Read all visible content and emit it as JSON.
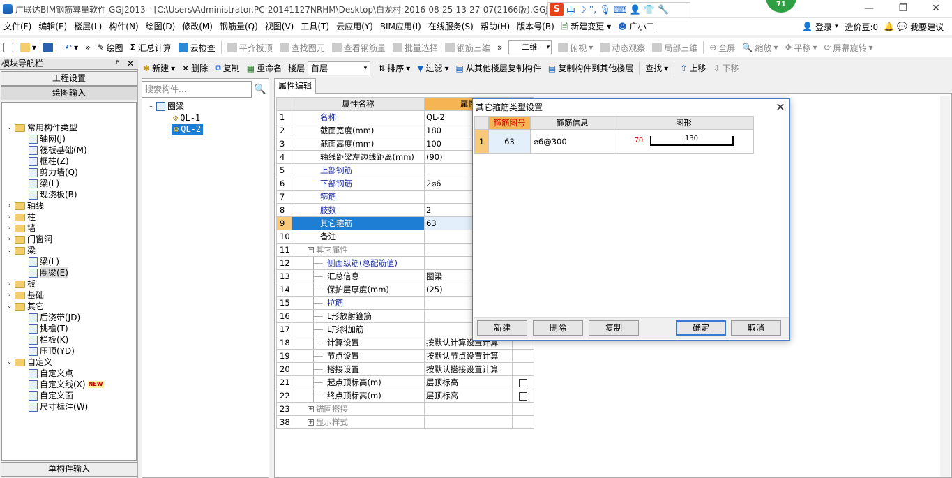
{
  "window": {
    "title": "广联达BIM钢筋算量软件 GGJ2013 - [C:\\Users\\Administrator.PC-20141127NRHM\\Desktop\\白龙村-2016-08-25-13-27-07(2166版).GGJ12]",
    "ime": {
      "logo": "S",
      "mode": "中"
    },
    "badge": "71",
    "controls": {
      "minimize": "—",
      "restore": "❐",
      "close": "✕"
    }
  },
  "menu": {
    "items": [
      "文件(F)",
      "编辑(E)",
      "楼层(L)",
      "构件(N)",
      "绘图(D)",
      "修改(M)",
      "钢筋量(Q)",
      "视图(V)",
      "工具(T)",
      "云应用(Y)",
      "BIM应用(I)",
      "在线服务(S)",
      "帮助(H)",
      "版本号(B)"
    ],
    "new_change": "新建变更",
    "assistant": "广小二",
    "login": "登录",
    "price_bean": "造价豆:0",
    "feedback": "我要建议"
  },
  "toolbar1": {
    "draw": "绘图",
    "sum": "汇总计算",
    "cloud_check": "云检查",
    "align_slab": "平齐板顶",
    "find_element": "查找图元",
    "view_rebar": "查看钢筋量",
    "batch_select": "批量选择",
    "rebar_3d": "钢筋三维",
    "view_mode": "二维",
    "top_view": "俯视",
    "dynamic_view": "动态观察",
    "local_3d": "局部三维",
    "fullscreen": "全屏",
    "zoom": "缩放",
    "pan": "平移",
    "rotate": "屏幕旋转"
  },
  "toolbar2": {
    "new": "新建",
    "delete": "删除",
    "copy": "复制",
    "rename": "重命名",
    "floor_label": "楼层",
    "floor_value": "首层",
    "sort": "排序",
    "filter": "过滤",
    "copy_from_floor": "从其他楼层复制构件",
    "copy_to_floor": "复制构件到其他楼层",
    "find": "查找",
    "move_up": "上移",
    "move_down": "下移"
  },
  "left_panel": {
    "title": "模块导航栏",
    "pin": "ᴾ",
    "close": "✕",
    "project_settings": "工程设置",
    "drawing_input": "绘图输入",
    "single_input": "单构件输入",
    "tree": [
      {
        "label": "常用构件类型",
        "level": 0,
        "exp": "⌄",
        "type": "folder"
      },
      {
        "label": "轴网(J)",
        "level": 1,
        "type": "item"
      },
      {
        "label": "筏板基础(M)",
        "level": 1,
        "type": "item"
      },
      {
        "label": "框柱(Z)",
        "level": 1,
        "type": "item"
      },
      {
        "label": "剪力墙(Q)",
        "level": 1,
        "type": "item"
      },
      {
        "label": "梁(L)",
        "level": 1,
        "type": "item"
      },
      {
        "label": "现浇板(B)",
        "level": 1,
        "type": "item"
      },
      {
        "label": "轴线",
        "level": 0,
        "exp": "›",
        "type": "folder"
      },
      {
        "label": "柱",
        "level": 0,
        "exp": "›",
        "type": "folder"
      },
      {
        "label": "墙",
        "level": 0,
        "exp": "›",
        "type": "folder"
      },
      {
        "label": "门窗洞",
        "level": 0,
        "exp": "›",
        "type": "folder"
      },
      {
        "label": "梁",
        "level": 0,
        "exp": "⌄",
        "type": "folder"
      },
      {
        "label": "梁(L)",
        "level": 1,
        "type": "item"
      },
      {
        "label": "圈梁(E)",
        "level": 1,
        "type": "item",
        "selected": true
      },
      {
        "label": "板",
        "level": 0,
        "exp": "›",
        "type": "folder"
      },
      {
        "label": "基础",
        "level": 0,
        "exp": "›",
        "type": "folder"
      },
      {
        "label": "其它",
        "level": 0,
        "exp": "⌄",
        "type": "folder"
      },
      {
        "label": "后浇带(JD)",
        "level": 1,
        "type": "item"
      },
      {
        "label": "挑檐(T)",
        "level": 1,
        "type": "item"
      },
      {
        "label": "栏板(K)",
        "level": 1,
        "type": "item"
      },
      {
        "label": "压顶(YD)",
        "level": 1,
        "type": "item"
      },
      {
        "label": "自定义",
        "level": 0,
        "exp": "⌄",
        "type": "folder"
      },
      {
        "label": "自定义点",
        "level": 1,
        "type": "item"
      },
      {
        "label": "自定义线(X)",
        "level": 1,
        "type": "item",
        "new": "NEW"
      },
      {
        "label": "自定义面",
        "level": 1,
        "type": "item"
      },
      {
        "label": "尺寸标注(W)",
        "level": 1,
        "type": "item"
      }
    ]
  },
  "component_tree": {
    "search_placeholder": "搜索构件...",
    "root": "圈梁",
    "items": [
      "QL-1",
      "QL-2"
    ],
    "selected": "QL-2"
  },
  "property_tab": "属性编辑",
  "property_table": {
    "headers": [
      "属性名称",
      "属性"
    ],
    "rows": [
      {
        "n": "1",
        "name": "名称",
        "value": "QL-2",
        "blue": true
      },
      {
        "n": "2",
        "name": "截面宽度(mm)",
        "value": "180"
      },
      {
        "n": "3",
        "name": "截面高度(mm)",
        "value": "100"
      },
      {
        "n": "4",
        "name": "轴线距梁左边线距离(mm)",
        "value": "(90)"
      },
      {
        "n": "5",
        "name": "上部钢筋",
        "value": "",
        "blue": true
      },
      {
        "n": "6",
        "name": "下部钢筋",
        "value": "2⌀6",
        "blue": true
      },
      {
        "n": "7",
        "name": "箍筋",
        "value": "",
        "blue": true
      },
      {
        "n": "8",
        "name": "肢数",
        "value": "2",
        "blue": true
      },
      {
        "n": "9",
        "name": "其它箍筋",
        "value": "63",
        "selected": true
      },
      {
        "n": "10",
        "name": "备注",
        "value": ""
      },
      {
        "n": "11",
        "name": "其它属性",
        "value": "",
        "group": "−",
        "gray": true
      },
      {
        "n": "12",
        "name": "侧面纵筋(总配筋值)",
        "value": "",
        "child": true,
        "blue": true
      },
      {
        "n": "13",
        "name": "汇总信息",
        "value": "圈梁",
        "child": true
      },
      {
        "n": "14",
        "name": "保护层厚度(mm)",
        "value": "(25)",
        "child": true
      },
      {
        "n": "15",
        "name": "拉筋",
        "value": "",
        "child": true,
        "blue": true
      },
      {
        "n": "16",
        "name": "L形放射箍筋",
        "value": "",
        "child": true
      },
      {
        "n": "17",
        "name": "L形斜加筋",
        "value": "",
        "child": true
      },
      {
        "n": "18",
        "name": "计算设置",
        "value": "按默认计算设置计算",
        "child": true
      },
      {
        "n": "19",
        "name": "节点设置",
        "value": "按默认节点设置计算",
        "child": true
      },
      {
        "n": "20",
        "name": "搭接设置",
        "value": "按默认搭接设置计算",
        "child": true
      },
      {
        "n": "21",
        "name": "起点顶标高(m)",
        "value": "层顶标高",
        "child": true,
        "check": true
      },
      {
        "n": "22",
        "name": "终点顶标高(m)",
        "value": "层顶标高",
        "child": true,
        "check": true
      },
      {
        "n": "23",
        "name": "锚固搭接",
        "value": "",
        "group": "+",
        "gray": true
      },
      {
        "n": "38",
        "name": "显示样式",
        "value": "",
        "group": "+",
        "gray": true
      }
    ]
  },
  "dialog": {
    "title": "其它箍筋类型设置",
    "close": "✕",
    "headers": [
      "箍筋图号",
      "箍筋信息",
      "图形"
    ],
    "rows": [
      {
        "n": "1",
        "code": "63",
        "info": "⌀6@300",
        "left": "70",
        "len": "130"
      }
    ],
    "buttons": {
      "new": "新建",
      "delete": "删除",
      "copy": "复制",
      "ok": "确定",
      "cancel": "取消"
    }
  }
}
